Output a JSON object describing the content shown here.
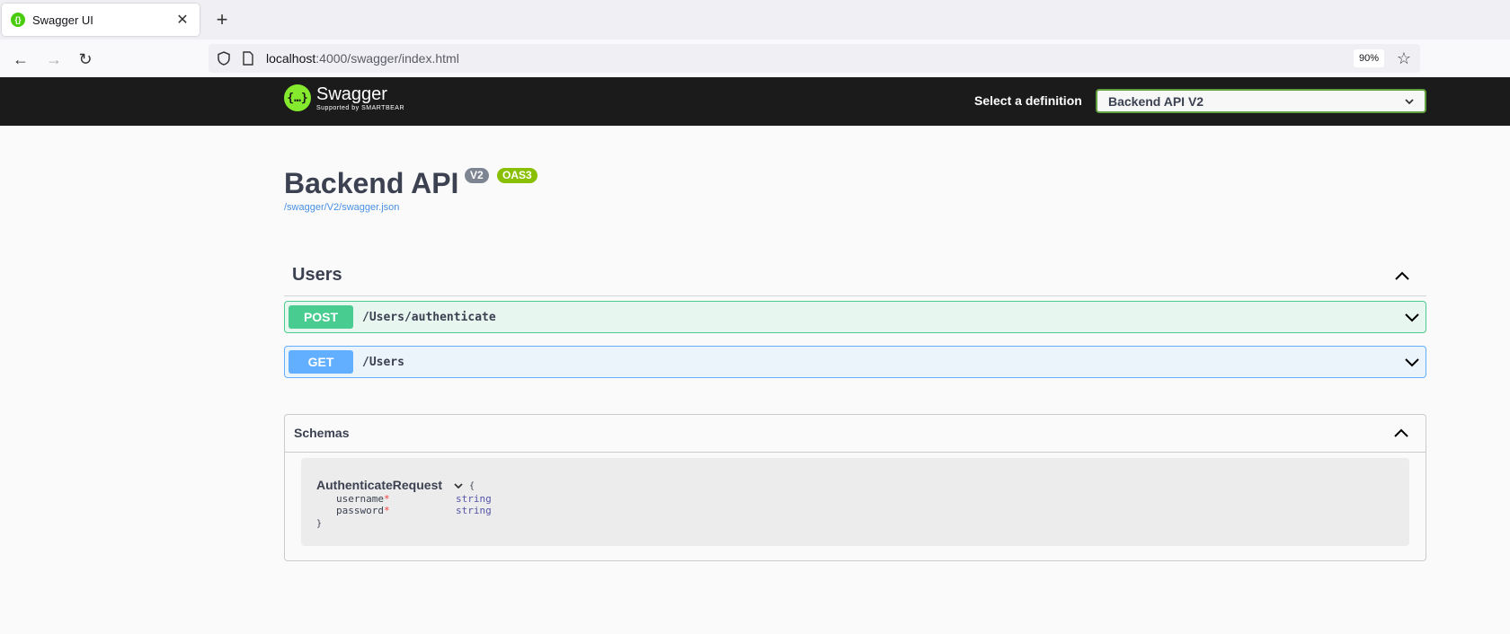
{
  "browser": {
    "tab_title": "Swagger UI",
    "favicon_glyph": "{}",
    "url_host": "localhost",
    "url_rest": ":4000/swagger/index.html",
    "zoom": "90%"
  },
  "topbar": {
    "logo_name": "Swagger",
    "logo_sub": "Supported by SMARTBEAR",
    "definition_label": "Select a definition",
    "definition_value": "Backend API V2"
  },
  "info": {
    "title": "Backend API",
    "version_badge": "V2",
    "oas_badge": "OAS3",
    "spec_url": "/swagger/V2/swagger.json"
  },
  "tags": [
    {
      "name": "Users",
      "operations": [
        {
          "method": "POST",
          "path": "/Users/authenticate"
        },
        {
          "method": "GET",
          "path": "/Users"
        }
      ]
    }
  ],
  "schemas": {
    "title": "Schemas",
    "models": [
      {
        "name": "AuthenticateRequest",
        "open_brace": "{",
        "close_brace": "}",
        "properties": [
          {
            "name": "username",
            "required_mark": "*",
            "type": "string"
          },
          {
            "name": "password",
            "required_mark": "*",
            "type": "string"
          }
        ]
      }
    ]
  },
  "colors": {
    "post": "#49cc90",
    "get": "#61affe",
    "topbar_bg": "#1b1b1b",
    "logo": "#85ea2d"
  }
}
